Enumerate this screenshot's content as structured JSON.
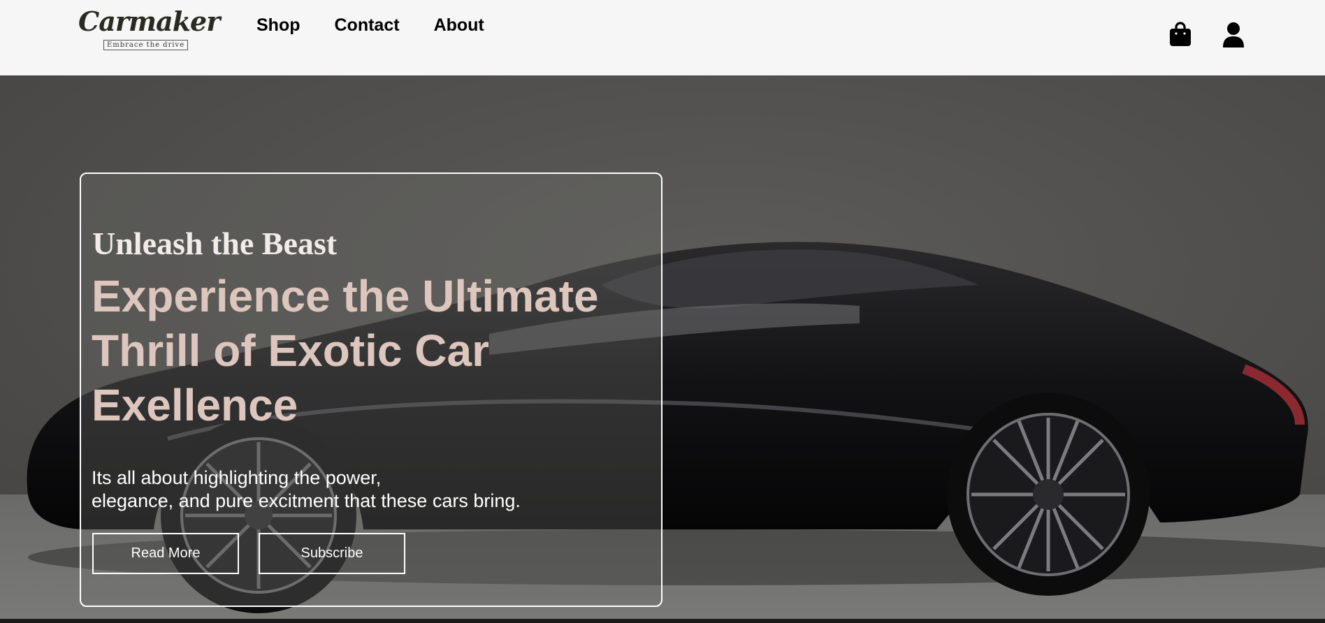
{
  "brand": {
    "name": "Carmaker",
    "tagline": "Embrace the drive"
  },
  "nav": {
    "items": [
      {
        "label": "Shop"
      },
      {
        "label": "Contact"
      },
      {
        "label": "About"
      }
    ]
  },
  "header_icons": {
    "cart": "shopping-bag-icon",
    "account": "user-icon"
  },
  "hero": {
    "eyebrow": "Unleash the Beast",
    "headline": "Experience the Ultimate Thrill of Exotic Car Exellence",
    "description_line1": "Its all about highlighting the power,",
    "description_line2": "elegance, and pure excitment that these cars bring.",
    "primary_button": "Read More",
    "secondary_button": "Subscribe"
  },
  "colors": {
    "header_bg": "#f6f6f6",
    "headline": "#dcc6bd",
    "eyebrow": "#f2ece8",
    "hero_bg": "#4f4e4c",
    "button_border": "#ffffff"
  }
}
